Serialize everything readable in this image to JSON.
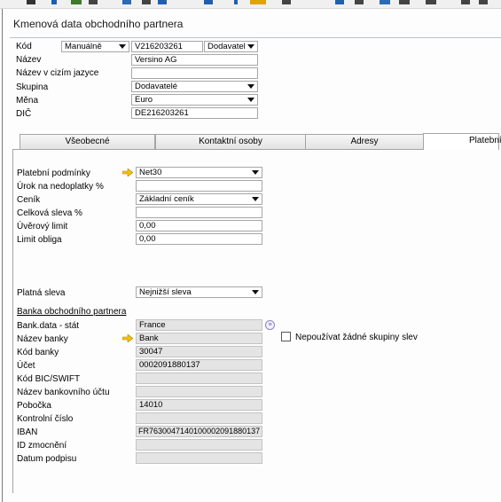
{
  "window": {
    "title": "Kmenová data obchodního partnera"
  },
  "header": {
    "code": {
      "label": "Kód",
      "series": "Manuálně",
      "value": "V216203261",
      "type": "Dodavatel"
    },
    "name": {
      "label": "Název",
      "value": "Versino AG"
    },
    "foreign_name": {
      "label": "Název v cizím jazyce",
      "value": ""
    },
    "group": {
      "label": "Skupina",
      "value": "Dodavatelé"
    },
    "currency": {
      "label": "Měna",
      "value": "Euro"
    },
    "tax_id": {
      "label": "DIČ",
      "value": "DE216203261"
    }
  },
  "tabs": [
    {
      "label": "Všeobecné",
      "active": false
    },
    {
      "label": "Kontaktní osoby",
      "active": false
    },
    {
      "label": "Adresy",
      "active": false
    },
    {
      "label": "Platební",
      "active": true
    }
  ],
  "payment": {
    "terms": {
      "label": "Platební podmínky",
      "value": "Net30"
    },
    "interest": {
      "label": "Úrok na nedoplatky %",
      "value": ""
    },
    "price_list": {
      "label": "Ceník",
      "value": "Základní ceník"
    },
    "total_discount": {
      "label": "Celková sleva %",
      "value": ""
    },
    "credit_limit": {
      "label": "Úvěrový limit",
      "value": "0,00"
    },
    "commitment_limit": {
      "label": "Limit obliga",
      "value": "0,00"
    },
    "effective_discount": {
      "label": "Platná sleva",
      "value": "Nejnižší sleva"
    },
    "no_discount_groups_label": "Nepoužívat žádné skupiny slev"
  },
  "bank": {
    "section_title": "Banka obchodního partnera",
    "rows": [
      {
        "label": "Bank.data - stát",
        "value": "France"
      },
      {
        "label": "Název banky",
        "value": "Bank"
      },
      {
        "label": "Kód banky",
        "value": "30047"
      },
      {
        "label": "Účet",
        "value": "0002091880137"
      },
      {
        "label": "Kód BIC/SWIFT",
        "value": ""
      },
      {
        "label": "Název bankovního účtu",
        "value": ""
      },
      {
        "label": "Pobočka",
        "value": "14010"
      },
      {
        "label": "Kontrolní číslo",
        "value": ""
      },
      {
        "label": "IBAN",
        "value": "FR7630047140100002091880137"
      },
      {
        "label": "ID zmocnění",
        "value": ""
      },
      {
        "label": "Datum podpisu",
        "value": ""
      }
    ]
  },
  "colors": {
    "link_arrow": "#f2c200",
    "readonly_bg": "#e4e4e4",
    "tab_border": "#a5a5a5"
  }
}
